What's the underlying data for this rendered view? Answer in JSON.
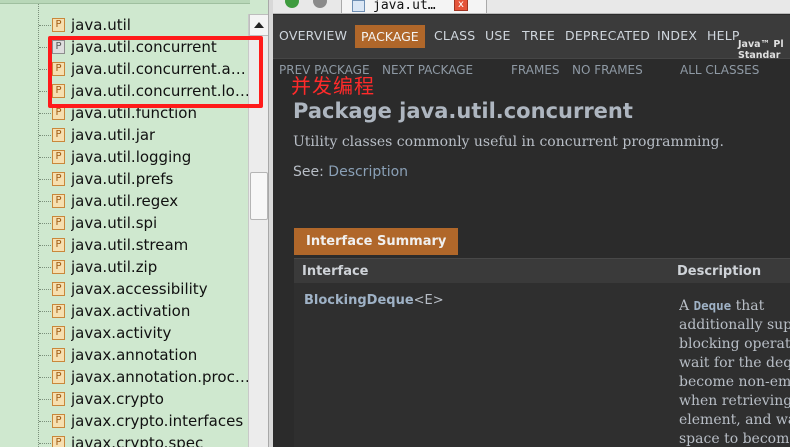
{
  "tree": {
    "items": [
      {
        "label": "java.util",
        "icon": "package-icon"
      },
      {
        "label": "java.util.concurrent",
        "icon": "package-grey-icon"
      },
      {
        "label": "java.util.concurrent.at…",
        "icon": "package-icon"
      },
      {
        "label": "java.util.concurrent.lo…",
        "icon": "package-icon"
      },
      {
        "label": "java.util.function",
        "icon": "package-icon"
      },
      {
        "label": "java.util.jar",
        "icon": "package-icon"
      },
      {
        "label": "java.util.logging",
        "icon": "package-icon"
      },
      {
        "label": "java.util.prefs",
        "icon": "package-icon"
      },
      {
        "label": "java.util.regex",
        "icon": "package-icon"
      },
      {
        "label": "java.util.spi",
        "icon": "package-icon"
      },
      {
        "label": "java.util.stream",
        "icon": "package-icon"
      },
      {
        "label": "java.util.zip",
        "icon": "package-icon"
      },
      {
        "label": "javax.accessibility",
        "icon": "package-icon"
      },
      {
        "label": "javax.activation",
        "icon": "package-icon"
      },
      {
        "label": "javax.activity",
        "icon": "package-icon"
      },
      {
        "label": "javax.annotation",
        "icon": "package-icon"
      },
      {
        "label": "javax.annotation.proc…",
        "icon": "package-icon"
      },
      {
        "label": "javax.crypto",
        "icon": "package-icon"
      },
      {
        "label": "javax.crypto.interfaces",
        "icon": "package-icon"
      },
      {
        "label": "javax.crypto.spec",
        "icon": "package-icon"
      }
    ],
    "icon_glyph": "P"
  },
  "annotation": {
    "note": "并发编程",
    "color": "#ff1a1a"
  },
  "tab": {
    "title": "java.ut…",
    "close_glyph": "x"
  },
  "nav": {
    "overview": "OVERVIEW",
    "package": "PACKAGE",
    "class": "CLASS",
    "use": "USE",
    "tree": "TREE",
    "deprecated": "DEPRECATED",
    "index": "INDEX",
    "help": "HELP",
    "brand_line1": "Java™ Pl",
    "brand_line2": "Standar",
    "accent": "#b0672a"
  },
  "subnav": {
    "prev": "PREV PACKAGE",
    "next": "NEXT PACKAGE",
    "frames": "FRAMES",
    "no_frames": "NO FRAMES",
    "all_classes": "ALL CLASSES"
  },
  "page": {
    "title": "Package java.util.concurrent",
    "description": "Utility classes commonly useful in concurrent programming.",
    "see_label": "See:",
    "see_link": "Description"
  },
  "summary": {
    "caption": "Interface Summary",
    "col_interface": "Interface",
    "col_description": "Description",
    "rows": [
      {
        "name": "BlockingDeque",
        "generic": "<E>",
        "desc_a": "A ",
        "desc_code": "Deque",
        "desc_b": " that",
        "desc_lines": [
          "additionally sup",
          "blocking operati",
          "wait for the deq",
          "become non-em",
          "when retrieving",
          "element, and wa",
          "space to become"
        ]
      }
    ]
  }
}
